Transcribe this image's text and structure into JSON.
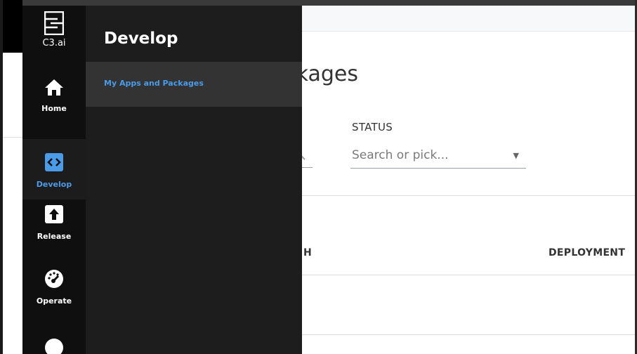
{
  "brand": {
    "name": "C3.ai"
  },
  "nav": {
    "items": [
      {
        "label": "Home",
        "icon": "home-icon"
      },
      {
        "label": "Develop",
        "icon": "code-icon",
        "active": true
      },
      {
        "label": "Release",
        "icon": "upload-icon"
      },
      {
        "label": "Operate",
        "icon": "gauge-icon"
      }
    ]
  },
  "drawer": {
    "title": "Develop",
    "items": [
      {
        "label": "My Apps and Packages",
        "active": true
      }
    ]
  },
  "main": {
    "title_partial": "Packages",
    "filters": {
      "status": {
        "label": "STATUS",
        "placeholder": "Search or pick..."
      }
    },
    "columns": [
      "H",
      "DEPLOYMENT"
    ]
  },
  "colors": {
    "accent": "#4a9be8",
    "rail_bg": "#0f0f0f",
    "drawer_bg": "#1d1d1d",
    "drawer_active": "#333333"
  }
}
